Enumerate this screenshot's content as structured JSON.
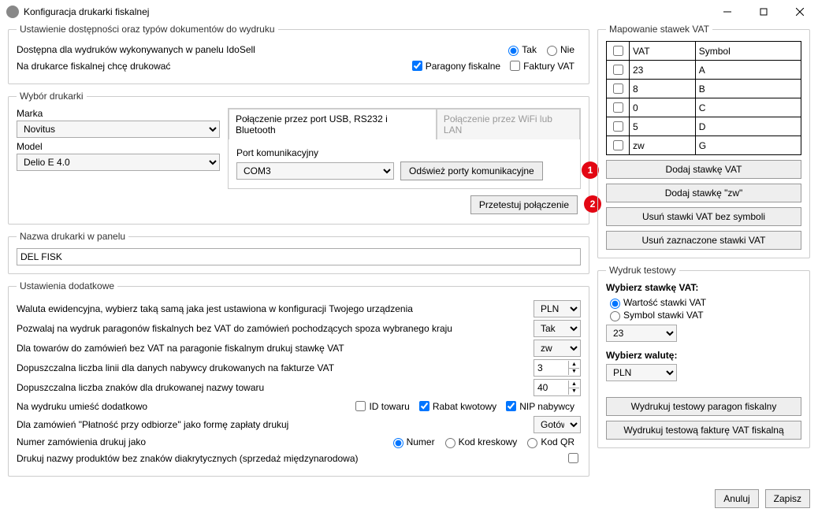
{
  "window": {
    "title": "Konfiguracja drukarki fiskalnej"
  },
  "availability": {
    "legend": "Ustawienie dostępności oraz typów dokumentów do wydruku",
    "line1": "Dostępna dla wydruków wykonywanych w panelu IdoSell",
    "yes": "Tak",
    "no": "Nie",
    "line2": "Na drukarce fiskalnej chcę drukować",
    "cb1": "Paragony fiskalne",
    "cb2": "Faktury VAT"
  },
  "printer": {
    "legend": "Wybór drukarki",
    "marka_lbl": "Marka",
    "marka_val": "Novitus",
    "model_lbl": "Model",
    "model_val": "Delio E 4.0",
    "tab1": "Połączenie przez port USB, RS232 i Bluetooth",
    "tab2": "Połączenie przez WiFi lub LAN",
    "port_lbl": "Port komunikacyjny",
    "port_val": "COM3",
    "refresh": "Odśwież porty komunikacyjne",
    "test": "Przetestuj połączenie",
    "b1": "1",
    "b2": "2"
  },
  "name": {
    "legend": "Nazwa drukarki w panelu",
    "val": "DEL FISK"
  },
  "extra": {
    "legend": "Ustawienia dodatkowe",
    "l1": "Waluta ewidencyjna, wybierz taką samą jaka jest ustawiona w konfiguracji Twojego urządzenia",
    "v1": "PLN",
    "l2": "Pozwalaj na wydruk paragonów fiskalnych bez VAT do zamówień pochodzących spoza wybranego kraju",
    "v2": "Tak",
    "l3": "Dla towarów do zamówień bez VAT na paragonie fiskalnym drukuj stawkę VAT",
    "v3": "zw",
    "l4": "Dopuszczalna liczba linii dla danych nabywcy drukowanych na fakturze VAT",
    "v4": "3",
    "l5": "Dopuszczalna liczba znaków dla drukowanej nazwy towaru",
    "v5": "40",
    "l6": "Na wydruku umieść dodatkowo",
    "cb_id": "ID towaru",
    "cb_rabat": "Rabat kwotowy",
    "cb_nip": "NIP nabywcy",
    "l7": "Dla zamówień \"Płatność przy odbiorze\" jako formę zapłaty drukuj",
    "v7": "Gotówka",
    "l8": "Numer zamówienia drukuj jako",
    "r1": "Numer",
    "r2": "Kod kreskowy",
    "r3": "Kod QR",
    "l9": "Drukuj nazwy produktów bez znaków diakrytycznych (sprzedaż międzynarodowa)"
  },
  "vat": {
    "legend": "Mapowanie stawek VAT",
    "h1": "VAT",
    "h2": "Symbol",
    "rows": [
      {
        "v": "23",
        "s": "A"
      },
      {
        "v": "8",
        "s": "B"
      },
      {
        "v": "0",
        "s": "C"
      },
      {
        "v": "5",
        "s": "D"
      },
      {
        "v": "zw",
        "s": "G"
      }
    ],
    "b1": "Dodaj stawkę VAT",
    "b2": "Dodaj stawkę \"zw\"",
    "b3": "Usuń stawki VAT bez symboli",
    "b4": "Usuń zaznaczone stawki VAT"
  },
  "test": {
    "legend": "Wydruk testowy",
    "h1": "Wybierz stawkę VAT:",
    "r1": "Wartość stawki VAT",
    "r2": "Symbol stawki VAT",
    "sel1": "23",
    "h2": "Wybierz walutę:",
    "sel2": "PLN",
    "b1": "Wydrukuj testowy paragon fiskalny",
    "b2": "Wydrukuj testową fakturę VAT fiskalną"
  },
  "footer": {
    "cancel": "Anuluj",
    "save": "Zapisz"
  }
}
